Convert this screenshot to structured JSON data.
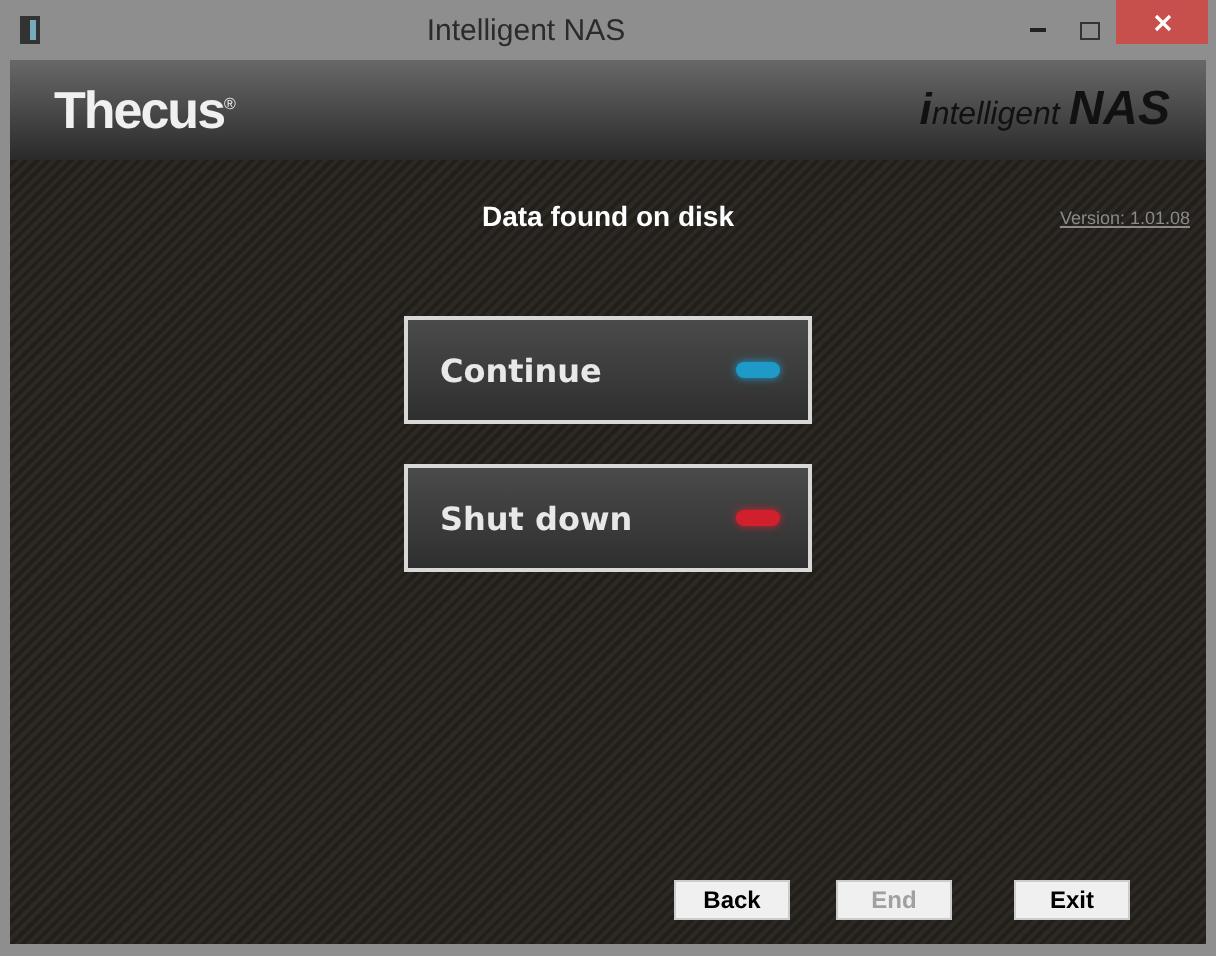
{
  "window": {
    "title": "Intelligent NAS"
  },
  "header": {
    "logo": "Thecus",
    "logo_mark": "®",
    "product_prefix": "i",
    "product_rest": "ntelligent",
    "product_suffix": "NAS"
  },
  "heading": "Data found on disk",
  "version": "Version: 1.01.08",
  "actions": [
    {
      "label": "Continue",
      "color": "#1e9ac8"
    },
    {
      "label": "Shut down",
      "color": "#d0202e"
    }
  ],
  "nav_buttons": [
    {
      "label": "Back",
      "disabled": false
    },
    {
      "label": "End",
      "disabled": true
    },
    {
      "label": "Exit",
      "disabled": false
    }
  ]
}
